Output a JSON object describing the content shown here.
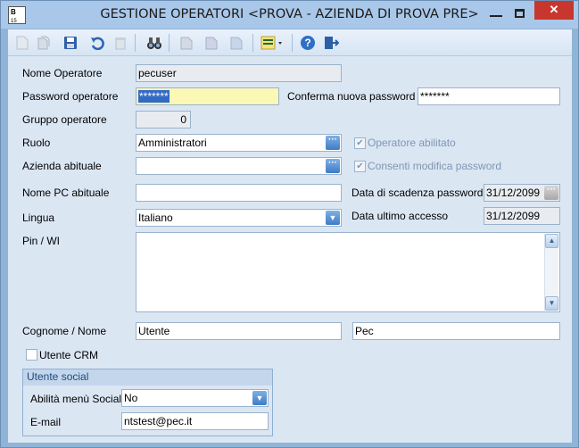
{
  "window": {
    "title": "GESTIONE OPERATORI <PROVA - AZIENDA DI PROVA PRE>",
    "app_icon_text": "B",
    "app_icon_sub": "15"
  },
  "toolbar": {
    "icons": [
      "new-icon",
      "copy-icon",
      "save-icon",
      "undo-icon",
      "delete-icon",
      "binoculars-icon",
      "doc-icon-1",
      "doc-icon-2",
      "doc-icon-3",
      "list-dropdown-icon",
      "help-icon",
      "exit-icon"
    ]
  },
  "form": {
    "nome_operatore": {
      "label": "Nome Operatore",
      "value": "pecuser"
    },
    "password": {
      "label": "Password operatore",
      "value": "*******"
    },
    "conferma_password": {
      "label": "Conferma nuova password",
      "value": "*******"
    },
    "gruppo": {
      "label": "Gruppo operatore",
      "value": "0"
    },
    "ruolo": {
      "label": "Ruolo",
      "value": "Amministratori"
    },
    "operatore_abilitato": {
      "label": "Operatore abilitato",
      "checked": true
    },
    "azienda": {
      "label": "Azienda abituale",
      "value": ""
    },
    "consenti_modifica": {
      "label": "Consenti modifica password",
      "checked": true
    },
    "nome_pc": {
      "label": "Nome PC abituale",
      "value": ""
    },
    "scadenza": {
      "label": "Data di scadenza password",
      "value": "31/12/2099"
    },
    "lingua": {
      "label": "Lingua",
      "value": "Italiano"
    },
    "ultimo_accesso": {
      "label": "Data ultimo accesso",
      "value": "31/12/2099"
    },
    "pin": {
      "label": "Pin / WI",
      "value": ""
    },
    "cognome_nome": {
      "label": "Cognome /  Nome",
      "cognome": "Utente",
      "nome": "Pec"
    },
    "utente_crm": {
      "label": "Utente CRM",
      "checked": false
    }
  },
  "social": {
    "title": "Utente social",
    "abilita_label": "Abilità menù Social",
    "abilita_value": "No",
    "email_label": "E-mail",
    "email_value": "ntstest@pec.it"
  },
  "colors": {
    "title_bar": "#a9c7e8",
    "content_bg": "#dbe6f3",
    "password_bg": "#fbf7b5",
    "close_button": "#c8372d"
  }
}
